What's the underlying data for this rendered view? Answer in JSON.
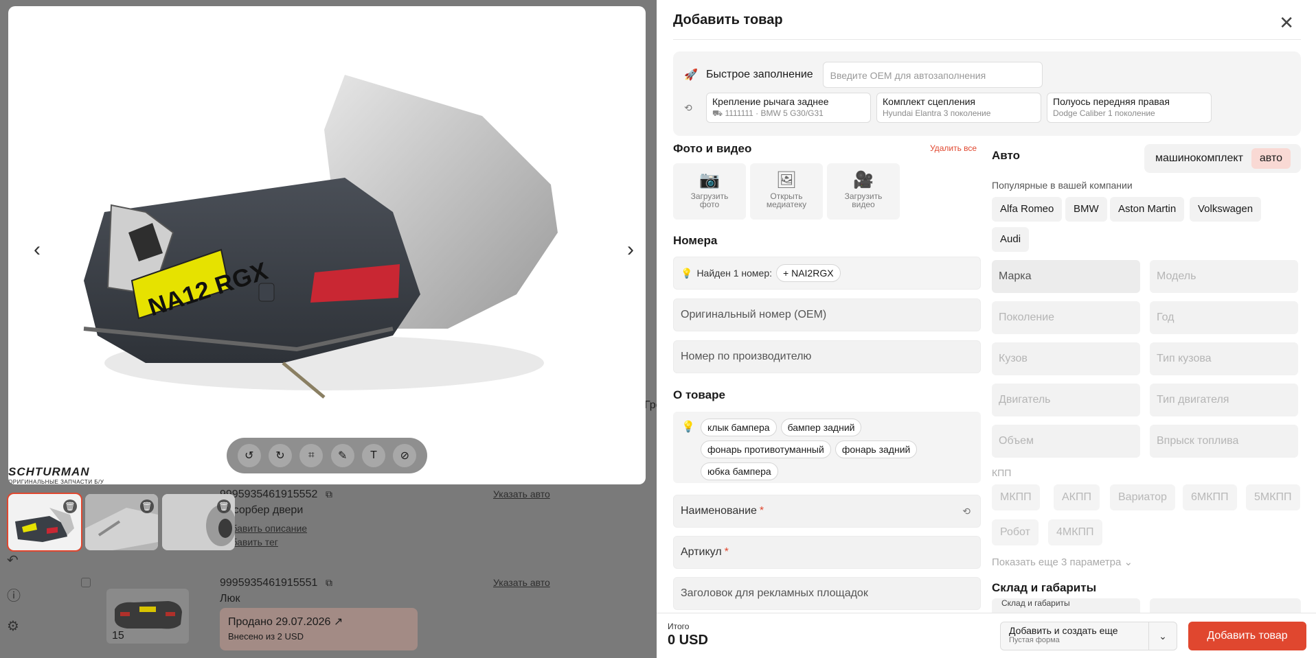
{
  "background": {
    "rows": [
      {
        "sku": "9995935461915552",
        "name": "Абсорбер двери",
        "link_desc": "Добавить описание",
        "link_tag": "Добавить тег",
        "link_auto": "Указать авто"
      },
      {
        "sku": "9995935461915551",
        "name": "Люк",
        "link_auto": "Указать авто",
        "count": "15",
        "sold": "Продано 29.07.2026 ↗",
        "sold_sub": "Внесено из 2 USD"
      }
    ],
    "partial_text": "Гре"
  },
  "viewer": {
    "watermark_main": "SCHTURMAN",
    "watermark_sub": "ОРИГИНАЛЬНЫЕ ЗАПЧАСТИ Б/У",
    "plate": "NA12 RGX"
  },
  "panel": {
    "title": "Добавить товар",
    "quick": {
      "label": "Быстрое заполнение",
      "placeholder": "Введите OEM для автозаполнения",
      "history": [
        {
          "title": "Крепление рычага заднее",
          "sub": "1111111 · BMW 5 G30/G31"
        },
        {
          "title": "Комплект сцепления",
          "sub": "Hyundai Elantra 3 поколение"
        },
        {
          "title": "Полуось передняя правая",
          "sub": "Dodge Caliber 1 поколение"
        }
      ]
    },
    "media": {
      "title": "Фото и видео",
      "delete_all": "Удалить все",
      "upload_photo": [
        "Загрузить",
        "фото"
      ],
      "open_library": [
        "Открыть",
        "медиатеку"
      ],
      "upload_video": [
        "Загрузить",
        "видео"
      ]
    },
    "numbers": {
      "title": "Номера",
      "found": "Найден 1 номер:",
      "chip": "+ NAI2RGX",
      "oem": "Оригинальный номер (OEM)",
      "manufacturer": "Номер по производителю"
    },
    "about": {
      "title": "О товаре",
      "tags": [
        "клык бампера",
        "бампер задний",
        "фонарь противотуманный",
        "фонарь задний",
        "юбка бампера"
      ],
      "name_field": "Наименование",
      "article_field": "Артикул",
      "ad_title": "Заголовок для рекламных площадок"
    },
    "auto": {
      "title": "Авто",
      "toggle": [
        "машинокомплект",
        "авто"
      ],
      "popular_label": "Популярные в вашей компании",
      "brands": [
        "Alfa Romeo",
        "BMW",
        "Aston Martin",
        "Volkswagen",
        "Audi"
      ],
      "fields": [
        "Марка",
        "Модель",
        "Поколение",
        "Год",
        "Кузов",
        "Тип кузова",
        "Двигатель",
        "Тип двигателя",
        "Объем",
        "Впрыск топлива"
      ],
      "gearbox_label": "КПП",
      "gearbox": [
        "МКПП",
        "АКПП",
        "Вариатор",
        "6МКПП",
        "5МКПП",
        "Робот",
        "4МКПП"
      ],
      "more": "Показать еще 3 параметра ⌄"
    },
    "warehouse": {
      "title": "Склад и габариты",
      "sub": "Склад и габариты"
    }
  },
  "footer": {
    "total_label": "Итого",
    "total_value": "0 USD",
    "add_more": "Добавить и создать еще",
    "add_more_sub": "Пустая форма",
    "add": "Добавить товар"
  },
  "colors": {
    "accent": "#e0472f"
  }
}
